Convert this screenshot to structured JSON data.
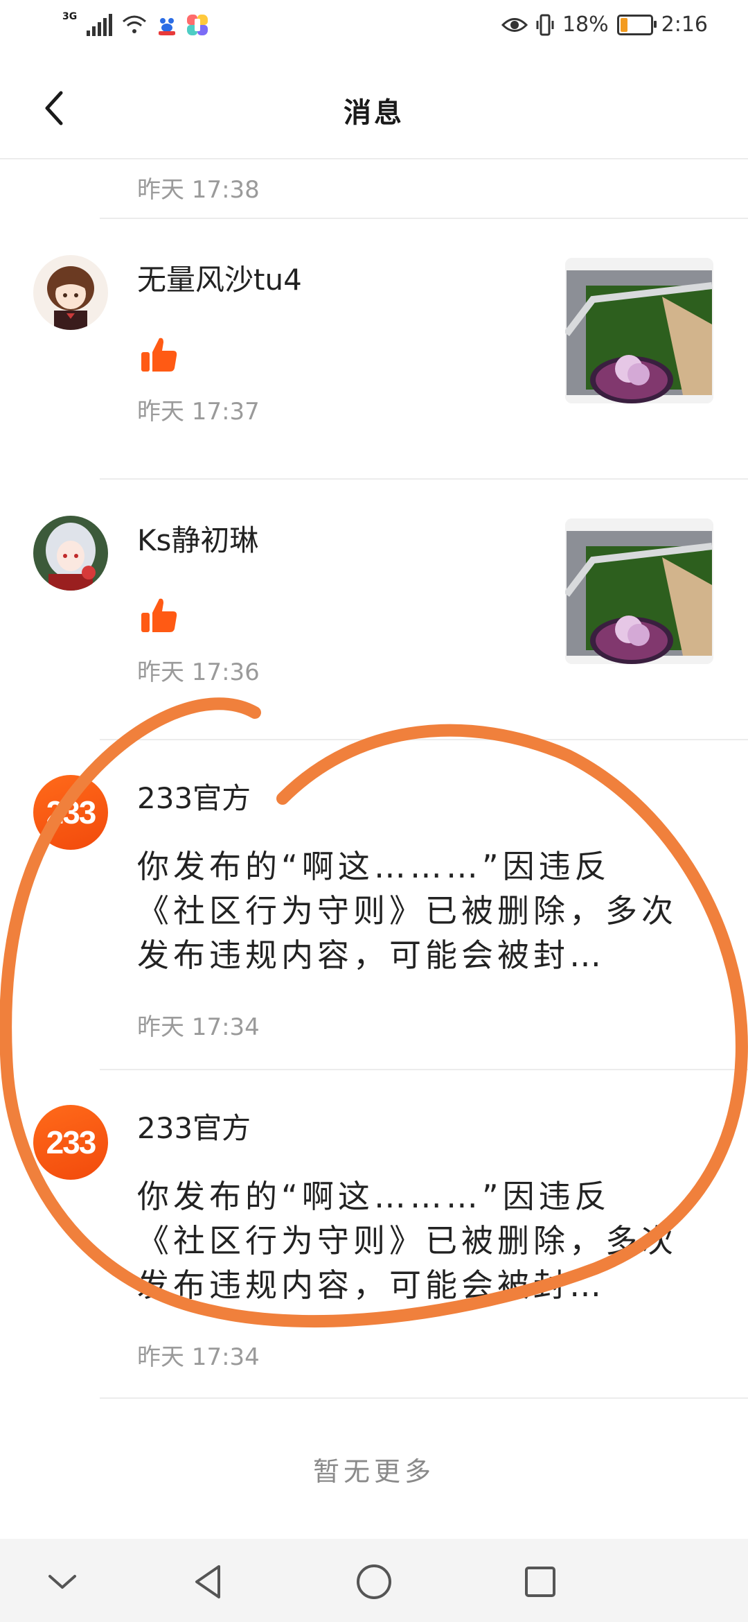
{
  "status_bar": {
    "network": "3G",
    "battery": "18%",
    "time": "2:16"
  },
  "header": {
    "title": "消息"
  },
  "top_time": "昨天 17:38",
  "items": [
    {
      "type": "like",
      "name": "无量风沙tu4",
      "time": "昨天 17:37"
    },
    {
      "type": "like",
      "name": "Ks静初琳",
      "time": "昨天 17:36"
    },
    {
      "type": "system",
      "logo": "233",
      "name": "233官方",
      "message": "你发布的“啊这………”因违反《社区行为守则》已被删除，多次发布违规内容，可能会被封…",
      "time": "昨天 17:34"
    },
    {
      "type": "system",
      "logo": "233",
      "name": "233官方",
      "message": "你发布的“啊这………”因违反《社区行为守则》已被删除，多次发布违规内容，可能会被封…",
      "time": "昨天 17:34"
    }
  ],
  "footer": {
    "no_more": "暂无更多"
  },
  "colors": {
    "accent": "#ff5a14",
    "annotation": "#f0803c"
  },
  "icons": [
    "back-arrow-icon",
    "thumbs-up-icon",
    "nav-back-icon",
    "nav-home-icon",
    "nav-recents-icon",
    "nav-collapse-icon"
  ]
}
